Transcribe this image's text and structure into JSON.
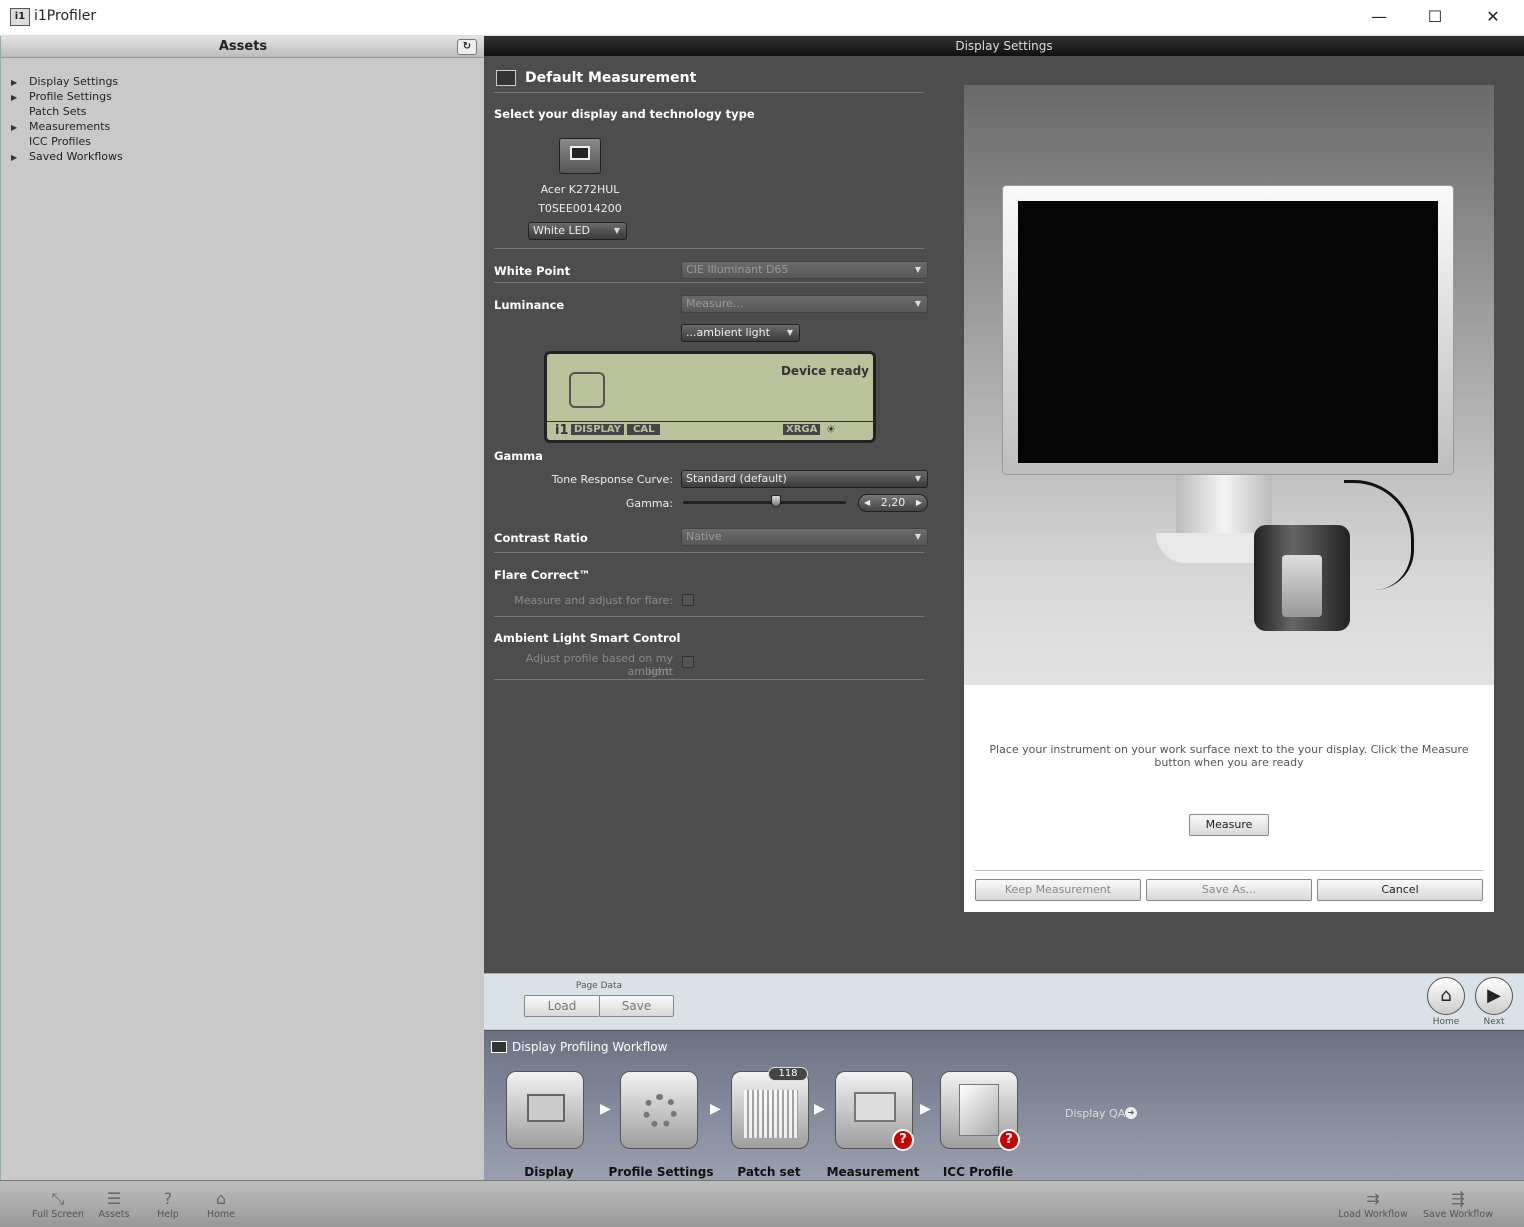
{
  "window": {
    "title": "i1Profiler",
    "logo": "i1",
    "minimize": "—",
    "maximize": "☐",
    "close": "✕"
  },
  "assets": {
    "header": "Assets",
    "items": [
      {
        "label": "Display Settings",
        "expandable": true
      },
      {
        "label": "Profile Settings",
        "expandable": true
      },
      {
        "label": "Patch Sets",
        "expandable": false
      },
      {
        "label": "Measurements",
        "expandable": true
      },
      {
        "label": "ICC Profiles",
        "expandable": false
      },
      {
        "label": "Saved Workflows",
        "expandable": true
      }
    ]
  },
  "display_settings": {
    "header": "Display Settings",
    "section_title": "Default Measurement",
    "select_label": "Select your display and technology type",
    "display_name": "Acer K272HUL",
    "display_serial": "T0SEE0014200",
    "technology": "White LED",
    "white_point": {
      "label": "White Point",
      "value": "CIE Illuminant D65"
    },
    "luminance": {
      "label": "Luminance",
      "value": "Measure...",
      "ambient": "...ambient light"
    },
    "device": {
      "status": "Device ready",
      "brand": "i1",
      "s1": "DISPLAY",
      "s2": "CAL",
      "s3": "XRGA"
    },
    "gamma": {
      "title": "Gamma",
      "trc_label": "Tone Response Curve:",
      "trc_value": "Standard (default)",
      "gamma_label": "Gamma:",
      "gamma_value": "2,20",
      "gamma_fraction": 0.57
    },
    "contrast": {
      "label": "Contrast Ratio",
      "value": "Native"
    },
    "flare": {
      "title": "Flare Correct™",
      "label": "Measure and adjust for flare:"
    },
    "ambient": {
      "title": "Ambient Light Smart Control",
      "label_1": "Adjust profile based on my ambient",
      "label_2": "light:"
    }
  },
  "preview": {
    "instruction": "Place your instrument on your work surface next to the your display. Click the Measure button when you are ready",
    "measure": "Measure",
    "keep": "Keep Measurement",
    "save_as": "Save As...",
    "cancel": "Cancel"
  },
  "page_data": {
    "label": "Page Data",
    "load": "Load",
    "save": "Save",
    "home": "Home",
    "next": "Next"
  },
  "workflow": {
    "title": "Display Profiling Workflow",
    "patch_count": "118",
    "steps": [
      "Display Settings",
      "Profile Settings",
      "Patch set",
      "Measurement",
      "ICC Profile"
    ],
    "display_qa": "Display QA",
    "qmark": "?"
  },
  "bottom": {
    "full_screen": "Full Screen",
    "assets": "Assets",
    "help": "Help",
    "home": "Home",
    "load_workflow": "Load Workflow",
    "save_workflow": "Save Workflow"
  }
}
